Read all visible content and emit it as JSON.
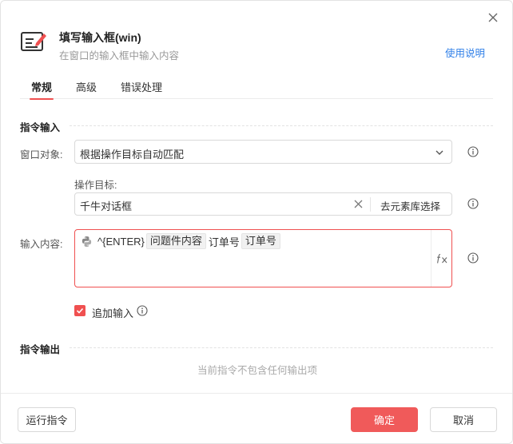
{
  "header": {
    "title": "填写输入框(win)",
    "subtitle": "在窗口的输入框中输入内容",
    "help_link": "使用说明"
  },
  "tabs": [
    {
      "label": "常规",
      "active": true
    },
    {
      "label": "高级",
      "active": false
    },
    {
      "label": "错误处理",
      "active": false
    }
  ],
  "input_section": {
    "title": "指令输入",
    "window_object": {
      "label": "窗口对象:",
      "value": "根据操作目标自动匹配"
    },
    "operation_target": {
      "label": "操作目标:",
      "value": "千牛对话框",
      "library_button": "去元素库选择"
    },
    "input_content": {
      "label": "输入内容:",
      "tokens": [
        {
          "type": "text",
          "value": "^{ENTER}"
        },
        {
          "type": "chip",
          "value": "问题件内容"
        },
        {
          "type": "text",
          "value": "订单号"
        },
        {
          "type": "chip",
          "value": "订单号"
        }
      ],
      "fx_icon": "fx-icon"
    },
    "append_input": {
      "label": "追加输入",
      "checked": true
    }
  },
  "output_section": {
    "title": "指令输出",
    "empty_message": "当前指令不包含任何输出项"
  },
  "footer": {
    "run_button": "运行指令",
    "confirm_button": "确定",
    "cancel_button": "取消"
  },
  "colors": {
    "accent": "#f05050",
    "link": "#2f7fe8"
  }
}
